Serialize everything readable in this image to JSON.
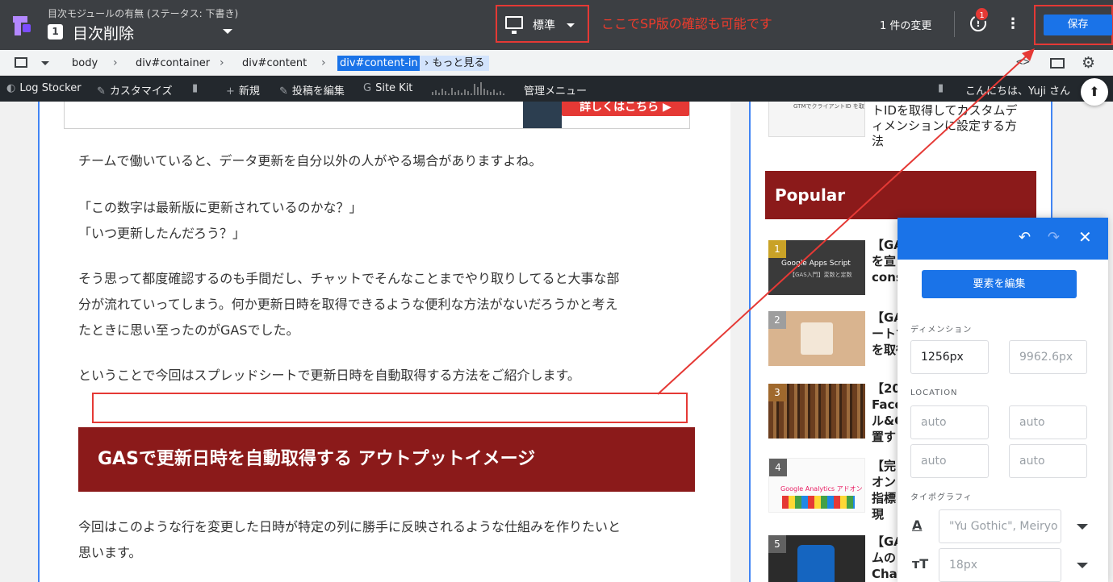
{
  "topbar": {
    "experiment_title": "目次モジュールの有無 (ステータス: 下書き)",
    "variant_number": "1",
    "variant_name": "目次削除",
    "device_label": "標準",
    "annotation": "ここでSP版の確認も可能です",
    "changes_count": "1 件の変更",
    "alert_count": "1",
    "save_label": "保存"
  },
  "pathbar": {
    "crumbs": [
      "body",
      "div#container",
      "div#content",
      "div#content-in"
    ],
    "more_label": "もっと見る"
  },
  "wpbar": {
    "site_name": "Log Stocker",
    "customize": "カスタマイズ",
    "new_post": "新規",
    "edit_post": "投稿を編集",
    "site_kit": "Site Kit",
    "admin_menu": "管理メニュー",
    "greeting": "こんにちは、Yuji さん"
  },
  "article": {
    "banner_cta": "詳しくはこちら ▶",
    "p1": "チームで働いていると、データ更新を自分以外の人がやる場合がありますよね。",
    "p2_line1": "「この数字は最新版に更新されているのかな？」",
    "p2_line2": "「いつ更新したんだろう？」",
    "p3_line1": "そう思って都度確認するのも手間だし、チャットでそんなことまでやり取りしてると大事な部",
    "p3_line2": "分が流れていってしまう。何か更新日時を取得できるような便利な方法がないだろうかと考え",
    "p3_line3": "たときに思い至ったのがGASでした。",
    "p4": "ということで今回はスプレッドシートで更新日時を自動取得する方法をご紹介します。",
    "heading": "GASで更新日時を自動取得する アウトプットイメージ",
    "p5_line1": "今回はこのような行を変更した日時が特定の列に勝手に反映されるような仕組みを作りたいと",
    "p5_line2": "思います。"
  },
  "sidebar": {
    "top_item_lines": [
      "トIDを取得してカスタムデ",
      "ィメンションに設定する方",
      "法"
    ],
    "top_thumb_text": "GTMでクライアントID を取得してみた",
    "popular_heading": "Popular",
    "items": [
      {
        "rank": "1",
        "lines": [
          "【GA",
          "を宣",
          "cons"
        ],
        "thumb_text": "Google Apps Script",
        "thumb_sub": "【GAS入門】変数と定数"
      },
      {
        "rank": "2",
        "lines": [
          "【GA",
          "ートで",
          "を取得"
        ]
      },
      {
        "rank": "3",
        "lines": [
          "【20",
          "Face",
          "ル&C",
          "置す"
        ]
      },
      {
        "rank": "4",
        "lines": [
          "【完",
          "オン",
          "指標",
          "現"
        ],
        "thumb_text": "Google Analytics アドオン"
      },
      {
        "rank": "5",
        "lines": [
          "【GA",
          "ムの",
          "Chat"
        ]
      }
    ]
  },
  "panel": {
    "edit_button": "要素を編集",
    "dimension_label": "ディメンション",
    "width_value": "1256px",
    "height_value": "9962.6px",
    "location_label": "LOCATION",
    "loc_placeholder": "auto",
    "typography_label": "タイポグラフィ",
    "font_family": "\"Yu Gothic\", Meiryo",
    "font_size": "18px"
  },
  "colors": {
    "accent": "#1a73e8",
    "annotation_red": "#e53935",
    "heading_bg": "#8b1a1a",
    "topbar_bg": "#3c3f43",
    "wpbar_bg": "#23282d"
  }
}
